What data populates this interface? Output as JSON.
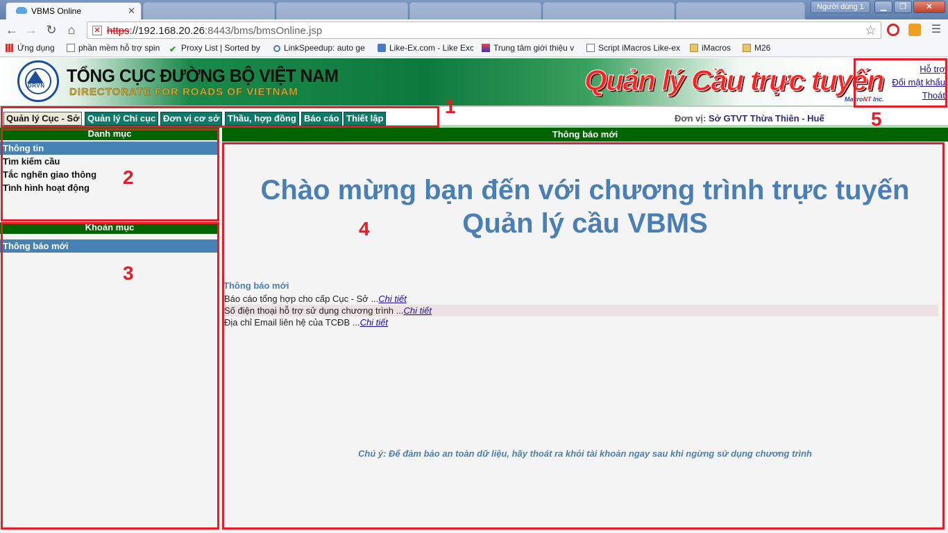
{
  "browser": {
    "tab_active": "VBMS Online",
    "tabs_inactive": [
      "",
      "",
      "",
      "",
      ""
    ],
    "user_badge": "Người dùng 1",
    "url_scheme": "https",
    "url_host": "://192.168.20.26",
    "url_rest": ":8443/bms/bmsOnline.jsp",
    "bookmarks": [
      {
        "label": "Ứng dụng",
        "icon": "apps-icon"
      },
      {
        "label": "phần mềm hỗ trợ spin",
        "icon": "page-icon"
      },
      {
        "label": "Proxy List | Sorted by",
        "icon": "check-icon"
      },
      {
        "label": "LinkSpeedup: auto ge",
        "icon": "link-icon"
      },
      {
        "label": "Like-Ex.com - Like Exc",
        "icon": "like-icon"
      },
      {
        "label": "Trung tâm giới thiệu v",
        "icon": "blog-icon"
      },
      {
        "label": "Script iMacros Like-ex",
        "icon": "page-icon"
      },
      {
        "label": "iMacros",
        "icon": "folder-icon"
      },
      {
        "label": "M26",
        "icon": "folder-icon"
      }
    ]
  },
  "header": {
    "org_vn": "TỔNG CỤC ĐƯỜNG BỘ VIỆT NAM",
    "org_en": "DIRECTORATE FOR ROADS OF VIETNAM",
    "logo_text": "DRVN",
    "app_title": "Quản lý Cầu trực tuyến",
    "vendor_a": "Macro",
    "vendor_b": "NT",
    "vendor_c": " Inc.",
    "links": {
      "help": "Hỗ trợ",
      "change_password": "Đổi mật khẩu",
      "logout": "Thoát"
    }
  },
  "menu": {
    "tabs": [
      "Quản lý Cục - Sở",
      "Quản lý Chi cục",
      "Đơn vị cơ sở",
      "Thầu, hợp đồng",
      "Báo cáo",
      "Thiết lập"
    ],
    "unit_label": "Đơn vị:",
    "unit_value": "Sở GTVT Thừa Thiên - Huế"
  },
  "sidebar": {
    "section1_title": "Danh mục",
    "section1_items": [
      "Thông tin",
      "Tìm kiếm cầu",
      "Tắc nghẽn giao thông",
      "Tình hình hoạt động"
    ],
    "section2_title": "Khoản mục",
    "section2_items": [
      "Thông báo mới"
    ]
  },
  "main": {
    "header": "Thông báo mới",
    "welcome_line1": "Chào mừng bạn đến với chương trình trực tuyến",
    "welcome_line2": "Quản lý cầu VBMS",
    "news_title": "Thông báo mới",
    "news": [
      {
        "text": "Báo cáo tổng hợp cho cấp Cục - Sở ...",
        "link": "Chi tiết"
      },
      {
        "text": "Số điện thoại hỗ trợ sử dụng chương trình ...",
        "link": "Chi tiết"
      },
      {
        "text": "Địa chỉ Email liên hệ của TCĐB ...",
        "link": "Chi tiết"
      }
    ],
    "note": "Chú ý: Để đảm bảo an toàn dữ liệu, hãy thoát ra khỏi tài khoản ngay sau khi ngừng sử dụng chương trình"
  },
  "annotations": [
    "1",
    "2",
    "3",
    "4",
    "5"
  ],
  "colors": {
    "menu_green": "#0d7a6a",
    "header_green": "#006400",
    "selected_blue": "#4682b4",
    "welcome_blue": "#4a7fb5",
    "annotation_red": "#e41e26"
  }
}
